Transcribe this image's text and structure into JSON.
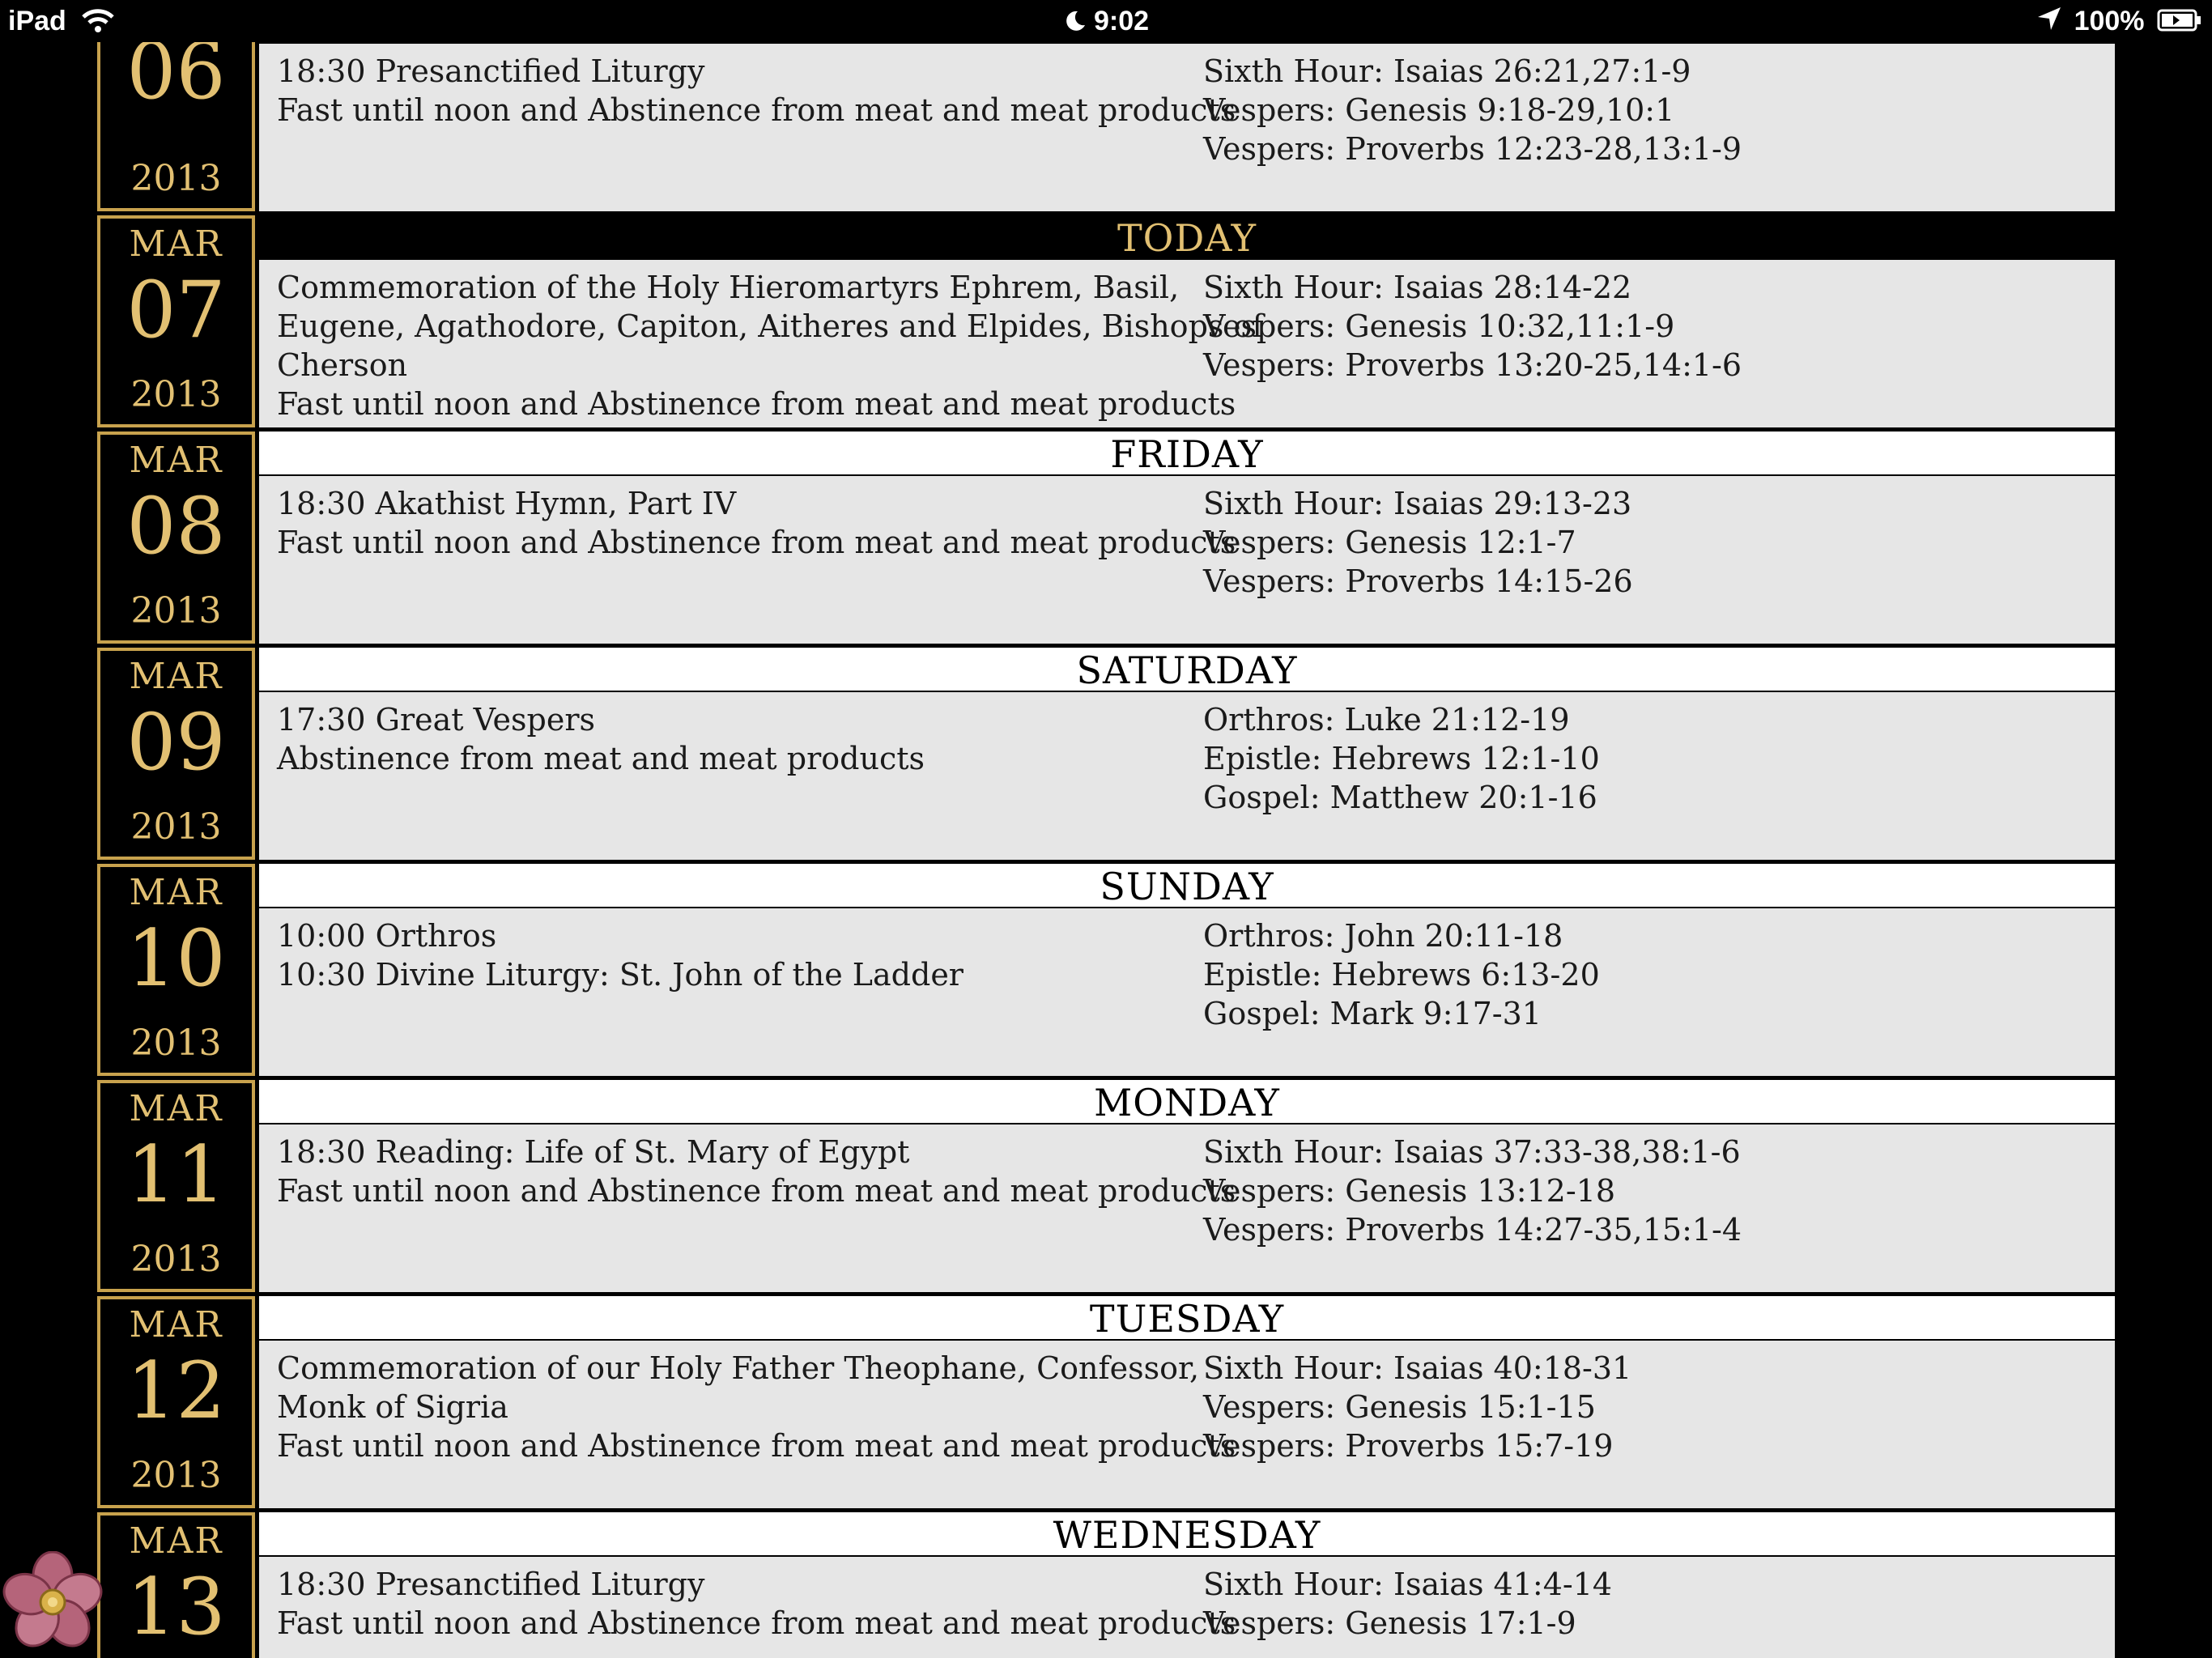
{
  "status_bar": {
    "device": "iPad",
    "time": "9:02",
    "battery": "100%",
    "icons": [
      "wifi-icon",
      "moon-icon",
      "location-arrow-icon",
      "battery-icon"
    ]
  },
  "colors": {
    "gold": "#e2c072",
    "gold_border": "#c8a24d",
    "row_bg": "#e6e6e6",
    "background": "#000000"
  },
  "days": [
    {
      "month": "",
      "day": "06",
      "year": "2013",
      "header": "",
      "events": [
        "18:30 Presanctified Liturgy",
        "Fast until noon and Abstinence from meat and meat products"
      ],
      "readings": [
        "Sixth Hour: Isaias 26:21,27:1-9",
        "Vespers: Genesis 9:18-29,10:1",
        "Vespers: Proverbs 12:23-28,13:1-9"
      ]
    },
    {
      "month": "MAR",
      "day": "07",
      "year": "2013",
      "header": "TODAY",
      "events": [
        "Commemoration of the Holy Hieromartyrs Ephrem, Basil,",
        "Eugene, Agathodore, Capiton, Aitheres and Elpides, Bishops of",
        "Cherson",
        "Fast until noon and Abstinence from meat and meat products"
      ],
      "readings": [
        "Sixth Hour: Isaias 28:14-22",
        "Vespers: Genesis 10:32,11:1-9",
        "Vespers: Proverbs 13:20-25,14:1-6"
      ]
    },
    {
      "month": "MAR",
      "day": "08",
      "year": "2013",
      "header": "FRIDAY",
      "events": [
        "18:30 Akathist Hymn, Part IV",
        "Fast until noon and Abstinence from meat and meat products"
      ],
      "readings": [
        "Sixth Hour: Isaias 29:13-23",
        "Vespers: Genesis 12:1-7",
        "Vespers: Proverbs 14:15-26"
      ]
    },
    {
      "month": "MAR",
      "day": "09",
      "year": "2013",
      "header": "SATURDAY",
      "events": [
        "17:30 Great Vespers",
        "Abstinence from meat and meat products"
      ],
      "readings": [
        "Orthros: Luke 21:12-19",
        "Epistle: Hebrews 12:1-10",
        "Gospel: Matthew 20:1-16"
      ]
    },
    {
      "month": "MAR",
      "day": "10",
      "year": "2013",
      "header": "SUNDAY",
      "events": [
        "10:00 Orthros",
        "10:30 Divine Liturgy: St. John of the Ladder"
      ],
      "readings": [
        "Orthros: John 20:11-18",
        "Epistle: Hebrews 6:13-20",
        "Gospel: Mark 9:17-31"
      ]
    },
    {
      "month": "MAR",
      "day": "11",
      "year": "2013",
      "header": "MONDAY",
      "events": [
        "18:30 Reading: Life of St. Mary of Egypt",
        "Fast until noon and Abstinence from meat and meat products"
      ],
      "readings": [
        "Sixth Hour: Isaias 37:33-38,38:1-6",
        "Vespers: Genesis 13:12-18",
        "Vespers: Proverbs 14:27-35,15:1-4"
      ]
    },
    {
      "month": "MAR",
      "day": "12",
      "year": "2013",
      "header": "TUESDAY",
      "events": [
        "Commemoration of our Holy Father Theophane, Confessor,",
        "Monk of Sigria",
        "Fast until noon and Abstinence from meat and meat products"
      ],
      "readings": [
        "Sixth Hour: Isaias 40:18-31",
        "Vespers: Genesis 15:1-15",
        "Vespers: Proverbs 15:7-19"
      ]
    },
    {
      "month": "MAR",
      "day": "13",
      "year": "",
      "header": "WEDNESDAY",
      "events": [
        "18:30 Presanctified Liturgy",
        "Fast until noon and Abstinence from meat and meat products"
      ],
      "readings": [
        "Sixth Hour: Isaias 41:4-14",
        "Vespers: Genesis 17:1-9"
      ]
    }
  ]
}
